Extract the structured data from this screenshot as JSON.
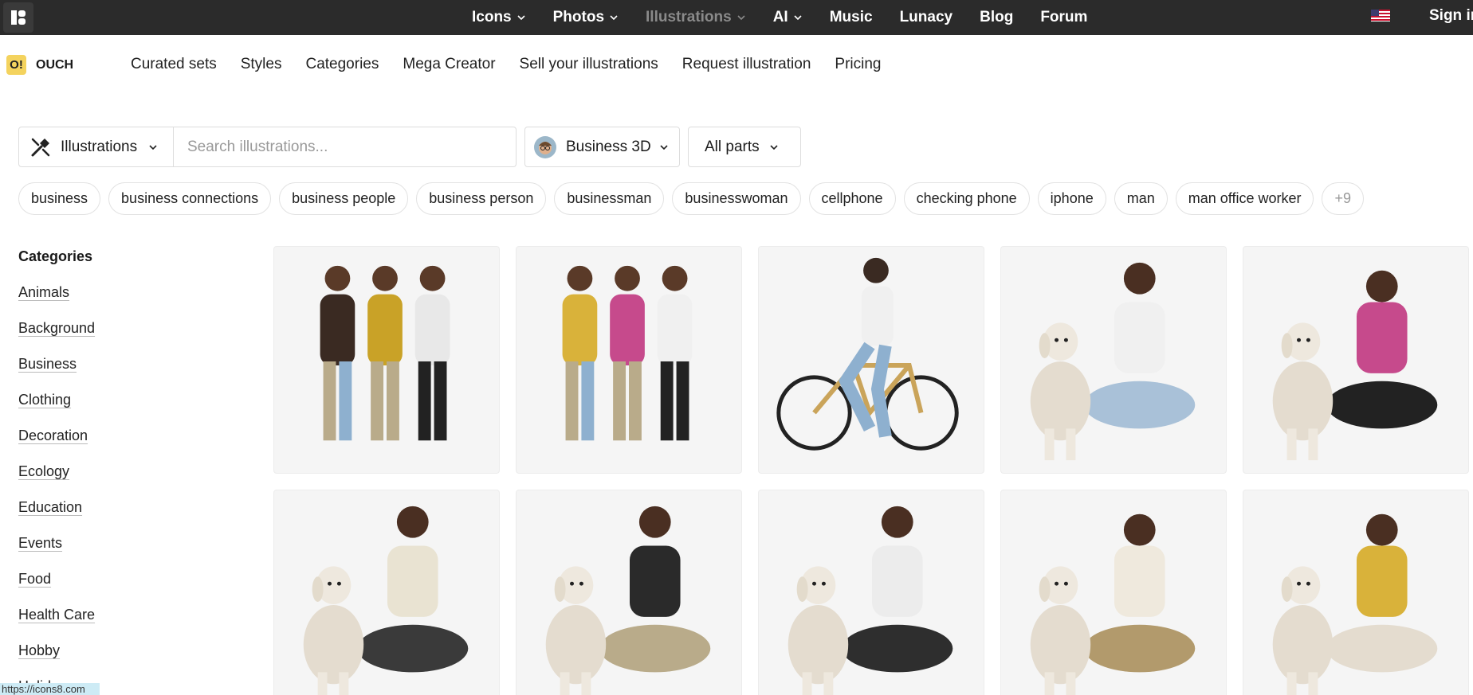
{
  "topbar": {
    "nav": [
      {
        "label": "Icons",
        "has_menu": true,
        "active": true
      },
      {
        "label": "Photos",
        "has_menu": true,
        "active": true
      },
      {
        "label": "Illustrations",
        "has_menu": true,
        "active": false
      },
      {
        "label": "AI",
        "has_menu": true,
        "active": true
      },
      {
        "label": "Music",
        "has_menu": false,
        "active": true
      },
      {
        "label": "Lunacy",
        "has_menu": false,
        "active": true
      },
      {
        "label": "Blog",
        "has_menu": false,
        "active": true
      },
      {
        "label": "Forum",
        "has_menu": false,
        "active": true
      }
    ],
    "sign_in": "Sign in"
  },
  "brand": {
    "badge": "O!",
    "name": "OUCH"
  },
  "subnav": [
    "Curated sets",
    "Styles",
    "Categories",
    "Mega Creator",
    "Sell your illustrations",
    "Request illustration",
    "Pricing"
  ],
  "search": {
    "type_label": "Illustrations",
    "placeholder": "Search illustrations...",
    "style_label": "Business 3D",
    "parts_label": "All parts"
  },
  "tags": [
    "business",
    "business connections",
    "business people",
    "business person",
    "businessman",
    "businesswoman",
    "cellphone",
    "checking phone",
    "iphone",
    "man",
    "man office worker",
    "+9"
  ],
  "sidebar": {
    "title": "Categories",
    "items": [
      "Animals",
      "Background",
      "Business",
      "Clothing",
      "Decoration",
      "Ecology",
      "Education",
      "Events",
      "Food",
      "Health Care",
      "Hobby",
      "Holidays"
    ]
  },
  "status_url": "https://icons8.com",
  "illustrations": [
    {
      "name": "three-friends-standing",
      "colors": [
        "#3a2a22",
        "#c9a227",
        "#e8e8e8"
      ]
    },
    {
      "name": "three-people-with-phones",
      "colors": [
        "#d9b23a",
        "#c64a8c",
        "#f0f0f0"
      ]
    },
    {
      "name": "man-riding-bicycle",
      "colors": [
        "#f0f0f0",
        "#8eb0cf",
        "#caa45a"
      ]
    },
    {
      "name": "man-high-five-dog",
      "colors": [
        "#f0f0f0",
        "#a9c1d8",
        "#e4dccf"
      ]
    },
    {
      "name": "woman-kneeling-with-dog",
      "colors": [
        "#c64a8c",
        "#222222",
        "#e4dccf"
      ]
    },
    {
      "name": "man-sitting-with-dog",
      "colors": [
        "#e9e3d2",
        "#3a3a3a",
        "#e4dccf"
      ]
    },
    {
      "name": "man-feeding-dog",
      "colors": [
        "#2a2a2a",
        "#b9ab8a",
        "#e4dccf"
      ]
    },
    {
      "name": "woman-sitting-with-dog",
      "colors": [
        "#ececec",
        "#2e2e2e",
        "#e4dccf"
      ]
    },
    {
      "name": "man-selfie-with-dog",
      "colors": [
        "#efe9dd",
        "#b29a6c",
        "#e4dccf"
      ]
    },
    {
      "name": "woman-phone-with-dog",
      "colors": [
        "#d9b23a",
        "#e4dccf",
        "#e4dccf"
      ]
    }
  ]
}
